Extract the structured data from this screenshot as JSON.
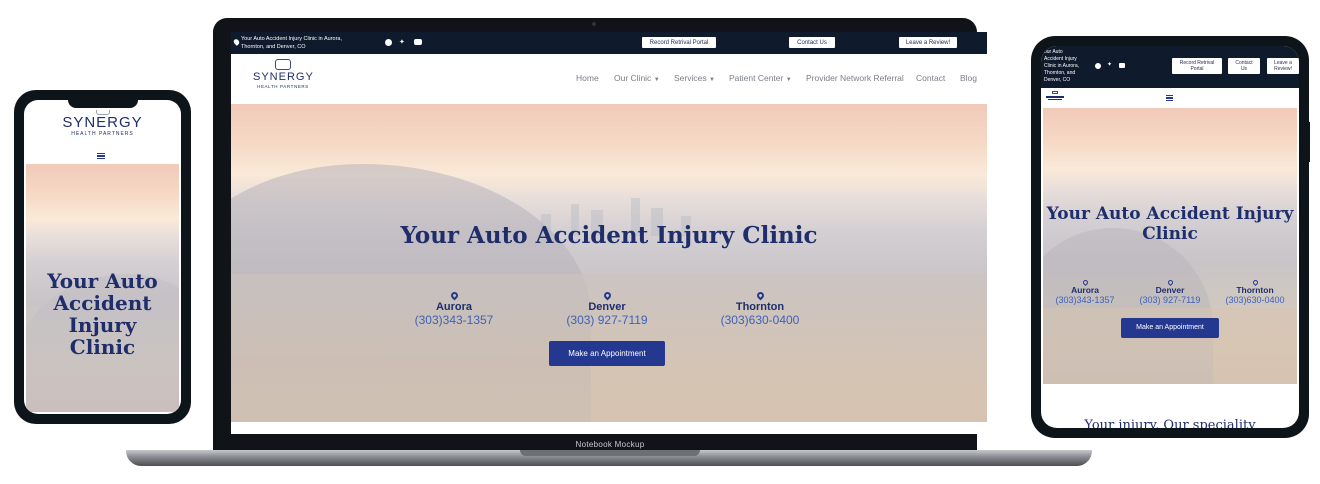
{
  "brand": {
    "name": "SYNERGY",
    "tagline": "HEALTH PARTNERS"
  },
  "topbar": {
    "address": "Your Auto Accident Injury Clinic in Aurora, Thornton, and Denver, CO",
    "address_line1": "Your Auto Accident Injury Clinic in Aurora,",
    "address_line2": "Thornton, and Denver, CO",
    "buttons": [
      "Record Retrival Portal",
      "Contact Us",
      "Leave a Review!"
    ]
  },
  "nav": {
    "items": [
      "Home",
      "Our Clinic",
      "Services",
      "Patient Center",
      "Provider Network Referral",
      "Contact",
      "Blog"
    ]
  },
  "hero": {
    "title": "Your Auto Accident Injury Clinic",
    "mobile_title_lines": [
      "Your Auto",
      "Accident",
      "Injury",
      "Clinic"
    ],
    "tablet_title_lines": [
      "Your Auto Accident Injury",
      "Clinic"
    ],
    "locations": [
      {
        "city": "Aurora",
        "phone": "(303)343-1357"
      },
      {
        "city": "Denver",
        "phone": "(303) 927-7119"
      },
      {
        "city": "Thornton",
        "phone": "(303)630-0400"
      }
    ],
    "cta": "Make an Appointment"
  },
  "tablet": {
    "address_lines": [
      "our Auto",
      "Accident Injury",
      "Clinic in Aurora,",
      "Thornton, and",
      "Denver, CO"
    ],
    "buttons": [
      [
        "Record Retrival",
        "Portal"
      ],
      [
        "Contact",
        "Us"
      ],
      [
        "Leave a",
        "Review!"
      ]
    ],
    "section_heading": "Your injury, Our speciality"
  },
  "laptop": {
    "label": "Notebook Mockup"
  },
  "colors": {
    "navy": "#1f2e6b",
    "accent": "#24388f",
    "phone": "#3e61b8",
    "topbar": "#0f1a2c",
    "bezel": "#0c1419"
  }
}
